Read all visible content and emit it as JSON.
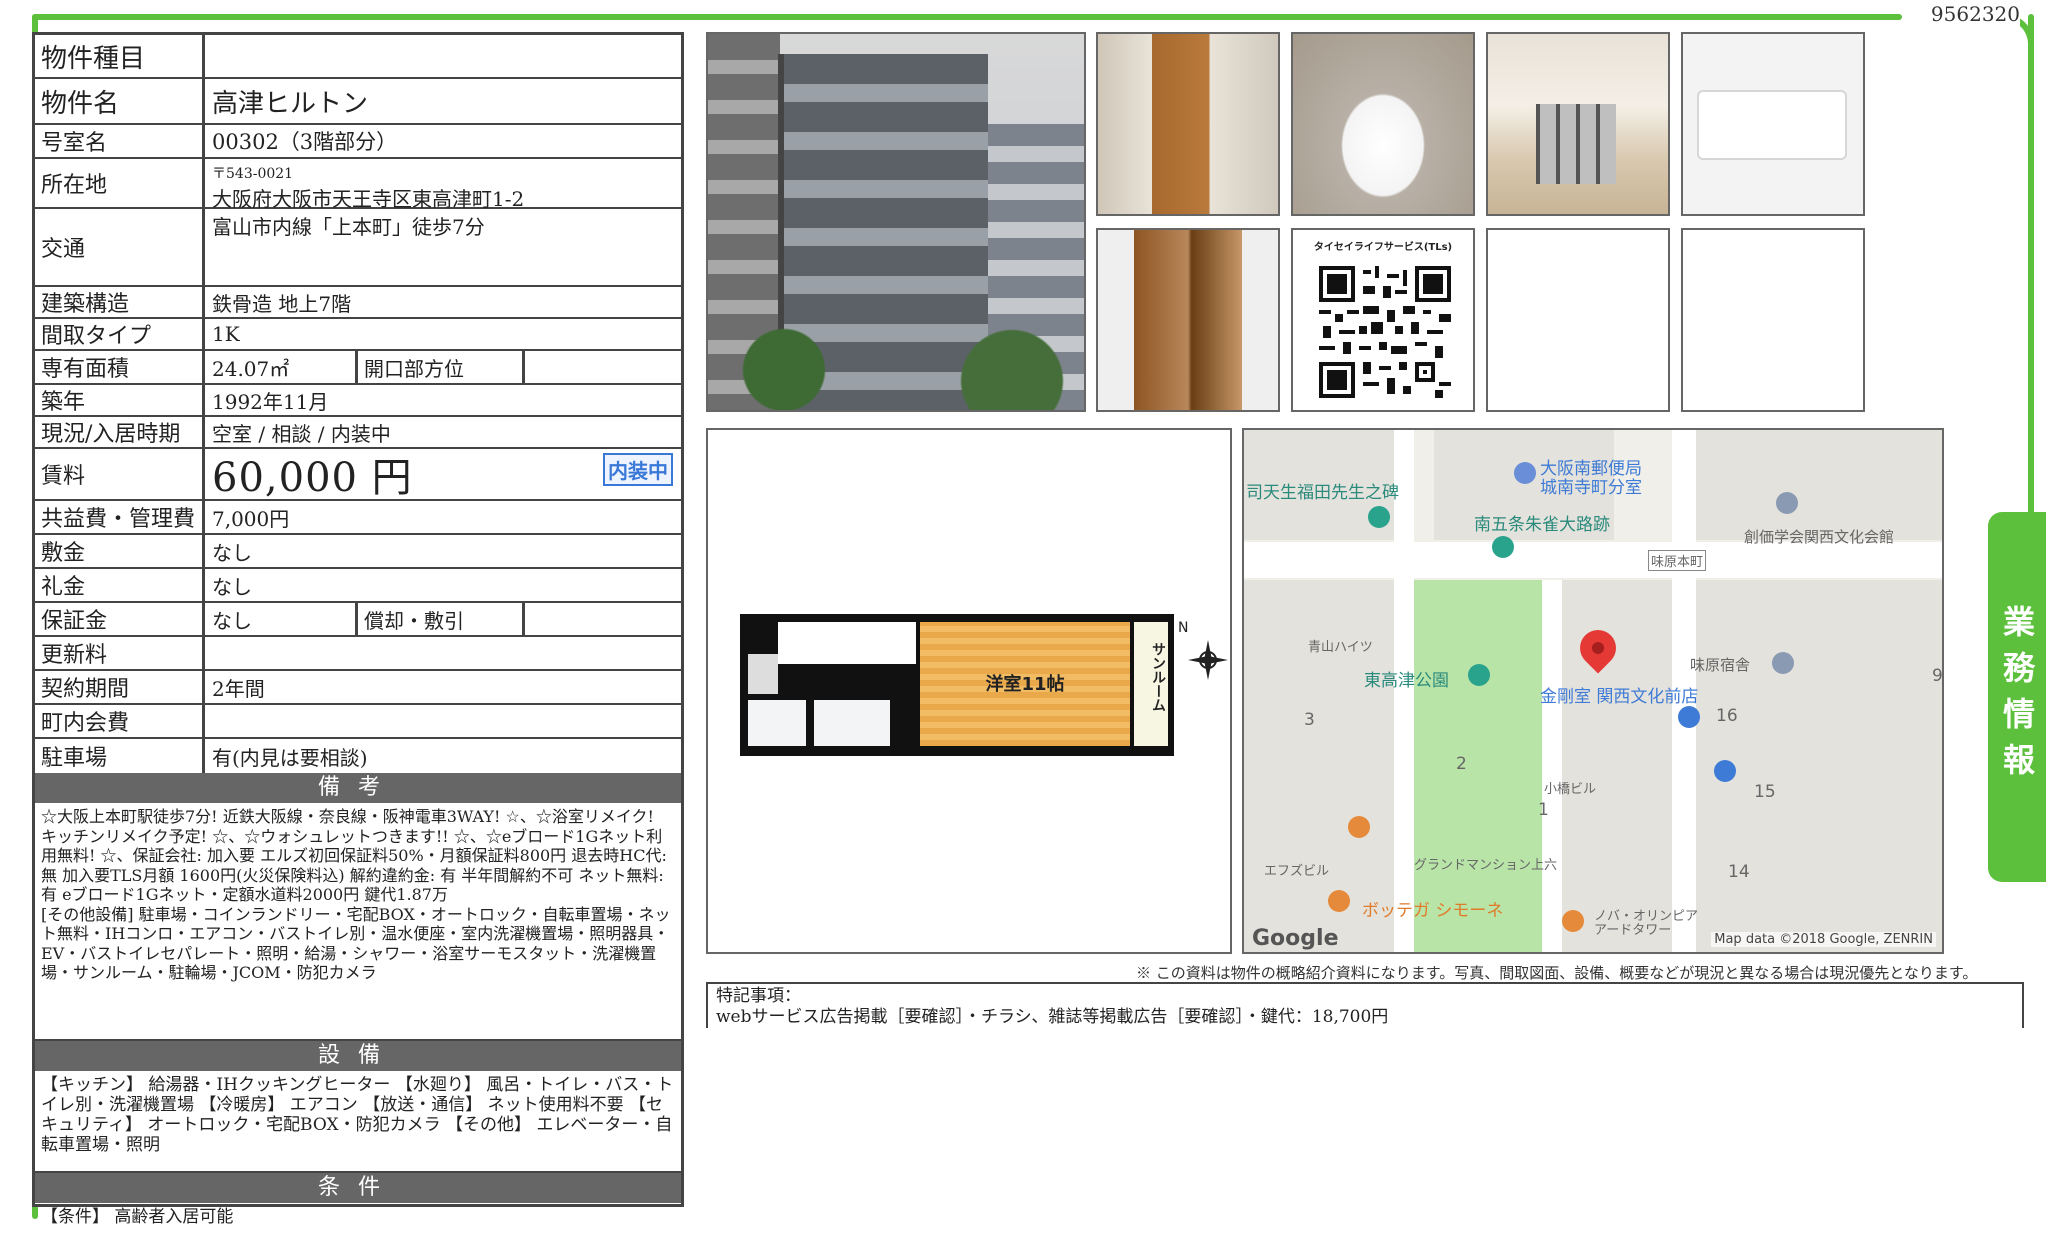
{
  "doc_id": "9562320",
  "side_tab": "業務情報",
  "info": {
    "type_label": "物件種目",
    "type_value": "",
    "name_label": "物件名",
    "name_value": "高津ヒルトン",
    "room_label": "号室名",
    "room_value": "00302（3階部分）",
    "address_label": "所在地",
    "address_zip": "〒543-0021",
    "address_value": "大阪府大阪市天王寺区東高津町1-2",
    "transport_label": "交通",
    "transport_value": "富山市内線「上本町」徒歩7分",
    "structure_label": "建築構造",
    "structure_value": "鉄骨造 地上7階",
    "layout_label": "間取タイプ",
    "layout_value": "1K",
    "area_label": "専有面積",
    "area_value": "24.07㎡",
    "direction_label": "開口部方位",
    "direction_value": "",
    "built_label": "築年",
    "built_value": "1992年11月",
    "status_label": "現況/入居時期",
    "status_value": "空室 / 相談 / 内装中",
    "rent_label": "賃料",
    "rent_value": "60,000 円",
    "rent_badge": "内装中",
    "fee_label": "共益費・管理費",
    "fee_value": "7,000円",
    "deposit_label": "敷金",
    "deposit_value": "なし",
    "keymoney_label": "礼金",
    "keymoney_value": "なし",
    "guarantee_label": "保証金",
    "guarantee_value": "なし",
    "amort_label": "償却・敷引",
    "amort_value": "",
    "renewal_label": "更新料",
    "renewal_value": "",
    "contract_label": "契約期間",
    "contract_value": "2年間",
    "community_label": "町内会費",
    "community_value": "",
    "parking_label": "駐車場",
    "parking_value": "有(内見は要相談)"
  },
  "remarks": {
    "title": "備考",
    "text": "☆大阪上本町駅徒歩7分! 近鉄大阪線・奈良線・阪神電車3WAY! ☆、☆浴室リメイク! キッチンリメイク予定! ☆、☆ウォシュレットつきます!! ☆、☆eブロード1Gネット利用無料! ☆、保証会社: 加入要 エルズ初回保証料50%・月額保証料800円 退去時HC代: 無 加入要TLS月額 1600円(火災保険料込) 解約違約金: 有 半年間解約不可 ネット無料: 有 eブロード1Gネット・定額水道料2000円 鍵代1.87万",
    "other": "[その他設備] 駐車場・コインランドリー・宅配BOX・オートロック・自転車置場・ネット無料・IHコンロ・エアコン・バストイレ別・温水便座・室内洗濯機置場・照明器具・EV・バストイレセパレート・照明・給湯・シャワー・浴室サーモスタット・洗濯機置場・サンルーム・駐輪場・JCOM・防犯カメラ"
  },
  "equipment": {
    "title": "設備",
    "text": "【キッチン】 給湯器・IHクッキングヒーター 【水廻り】 風呂・トイレ・バス・トイレ別・洗濯機置場 【冷暖房】 エアコン 【放送・通信】 ネット使用料不要 【セキュリティ】 オートロック・宅配BOX・防犯カメラ 【その他】 エレベーター・自転車置場・照明"
  },
  "conditions": {
    "title": "条件",
    "text": "【条件】 高齢者入居可能"
  },
  "photos": {
    "qr_title": "タイセイライフサービス(TLs)"
  },
  "floorplan": {
    "room_label": "洋室11帖",
    "sunroom_label": "サンルーム",
    "north": "N"
  },
  "map": {
    "labels": {
      "post_office": "大阪南郵便局\n城南寺町分室",
      "monument": "司天生福田先生之碑",
      "suzaku": "南五条朱雀大路跡",
      "soka": "創価学会関西文化会館",
      "mihara": "味原本町",
      "aoyama": "青山ハイツ",
      "park": "東高津公園",
      "kongo": "金剛室 関西文化前店",
      "mihara_inn": "味原宿舎",
      "kobashi": "小橋ビル",
      "grand": "グランドマンション上六",
      "efbuild": "エフズビル",
      "bottega": "ボッテガ シモーネ",
      "noba": "ノバ・オリンピア\nアードタワー",
      "n3": "3",
      "n2": "2",
      "n1": "1",
      "n16": "16",
      "n15": "15",
      "n14": "14",
      "n9": "9"
    },
    "google": "Google",
    "attribution": "Map data ©2018 Google, ZENRIN"
  },
  "disclaimer": "※ この資料は物件の概略紹介資料になります。写真、間取図面、設備、概要などが現況と異なる場合は現況優先となります。",
  "notes": {
    "title": "特記事項：",
    "text": "webサービス広告掲載［要確認］・チラシ、雑誌等掲載広告［要確認］・鍵代：18,700円"
  }
}
